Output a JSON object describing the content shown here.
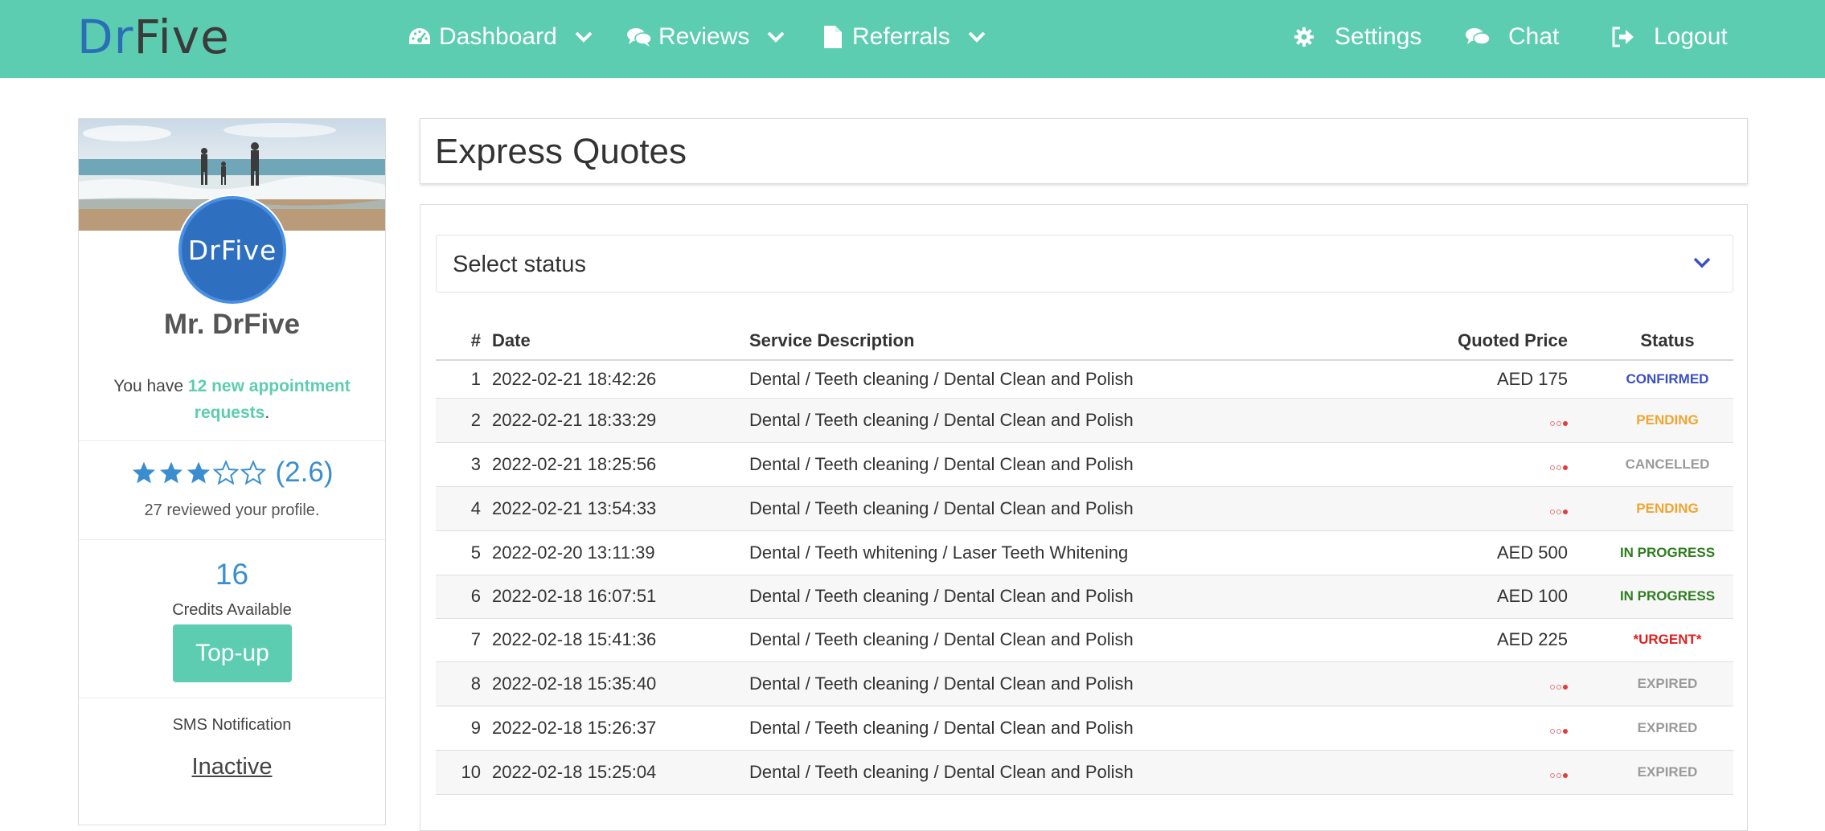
{
  "brand": {
    "logo_dr": "Dr",
    "logo_five": "Five"
  },
  "nav": {
    "dashboard": "Dashboard",
    "reviews": "Reviews",
    "referrals": "Referrals",
    "settings": "Settings",
    "chat": "Chat",
    "logout": "Logout"
  },
  "colors": {
    "accent": "#5ccdb0",
    "brand_blue": "#2a6fb5",
    "link_blue": "#3a8ed0"
  },
  "profile": {
    "avatar_text": "DrFive",
    "name": "Mr. DrFive",
    "appt_prefix": "You have ",
    "appt_link": "12 new appointment requests",
    "appt_suffix": ".",
    "rating": "(2.6)",
    "rating_stars_filled": 3,
    "rating_stars_total": 5,
    "reviewed": "27 reviewed your profile.",
    "credits": "16",
    "credits_label": "Credits Available",
    "topup": "Top-up",
    "sms_label": "SMS Notification",
    "sms_value": "Inactive"
  },
  "main": {
    "title": "Express Quotes",
    "select_status": "Select status",
    "columns": [
      "#",
      "Date",
      "Service Description",
      "Quoted Price",
      "Status"
    ],
    "rows": [
      {
        "n": "1",
        "date": "2022-02-21 18:42:26",
        "desc": "Dental / Teeth cleaning / Dental Clean and Polish",
        "price": "AED 175",
        "status": "CONFIRMED",
        "status_color": "#3b4fc4"
      },
      {
        "n": "2",
        "date": "2022-02-21 18:33:29",
        "desc": "Dental / Teeth cleaning / Dental Clean and Polish",
        "price": "",
        "status": "PENDING",
        "status_color": "#f0a530"
      },
      {
        "n": "3",
        "date": "2022-02-21 18:25:56",
        "desc": "Dental / Teeth cleaning / Dental Clean and Polish",
        "price": "",
        "status": "CANCELLED",
        "status_color": "#9a9a9a"
      },
      {
        "n": "4",
        "date": "2022-02-21 13:54:33",
        "desc": "Dental / Teeth cleaning / Dental Clean and Polish",
        "price": "",
        "status": "PENDING",
        "status_color": "#f0a530"
      },
      {
        "n": "5",
        "date": "2022-02-20 13:11:39",
        "desc": "Dental / Teeth whitening / Laser Teeth Whitening",
        "price": "AED 500",
        "status": "IN PROGRESS",
        "status_color": "#2f7d1f"
      },
      {
        "n": "6",
        "date": "2022-02-18 16:07:51",
        "desc": "Dental / Teeth cleaning / Dental Clean and Polish",
        "price": "AED 100",
        "status": "IN PROGRESS",
        "status_color": "#2f7d1f"
      },
      {
        "n": "7",
        "date": "2022-02-18 15:41:36",
        "desc": "Dental / Teeth cleaning / Dental Clean and Polish",
        "price": "AED 225",
        "status": "*URGENT*",
        "status_color": "#e01e1e"
      },
      {
        "n": "8",
        "date": "2022-02-18 15:35:40",
        "desc": "Dental / Teeth cleaning / Dental Clean and Polish",
        "price": "",
        "status": "EXPIRED",
        "status_color": "#9a9a9a"
      },
      {
        "n": "9",
        "date": "2022-02-18 15:26:37",
        "desc": "Dental / Teeth cleaning / Dental Clean and Polish",
        "price": "",
        "status": "EXPIRED",
        "status_color": "#9a9a9a"
      },
      {
        "n": "10",
        "date": "2022-02-18 15:25:04",
        "desc": "Dental / Teeth cleaning / Dental Clean and Polish",
        "price": "",
        "status": "EXPIRED",
        "status_color": "#9a9a9a"
      }
    ]
  }
}
